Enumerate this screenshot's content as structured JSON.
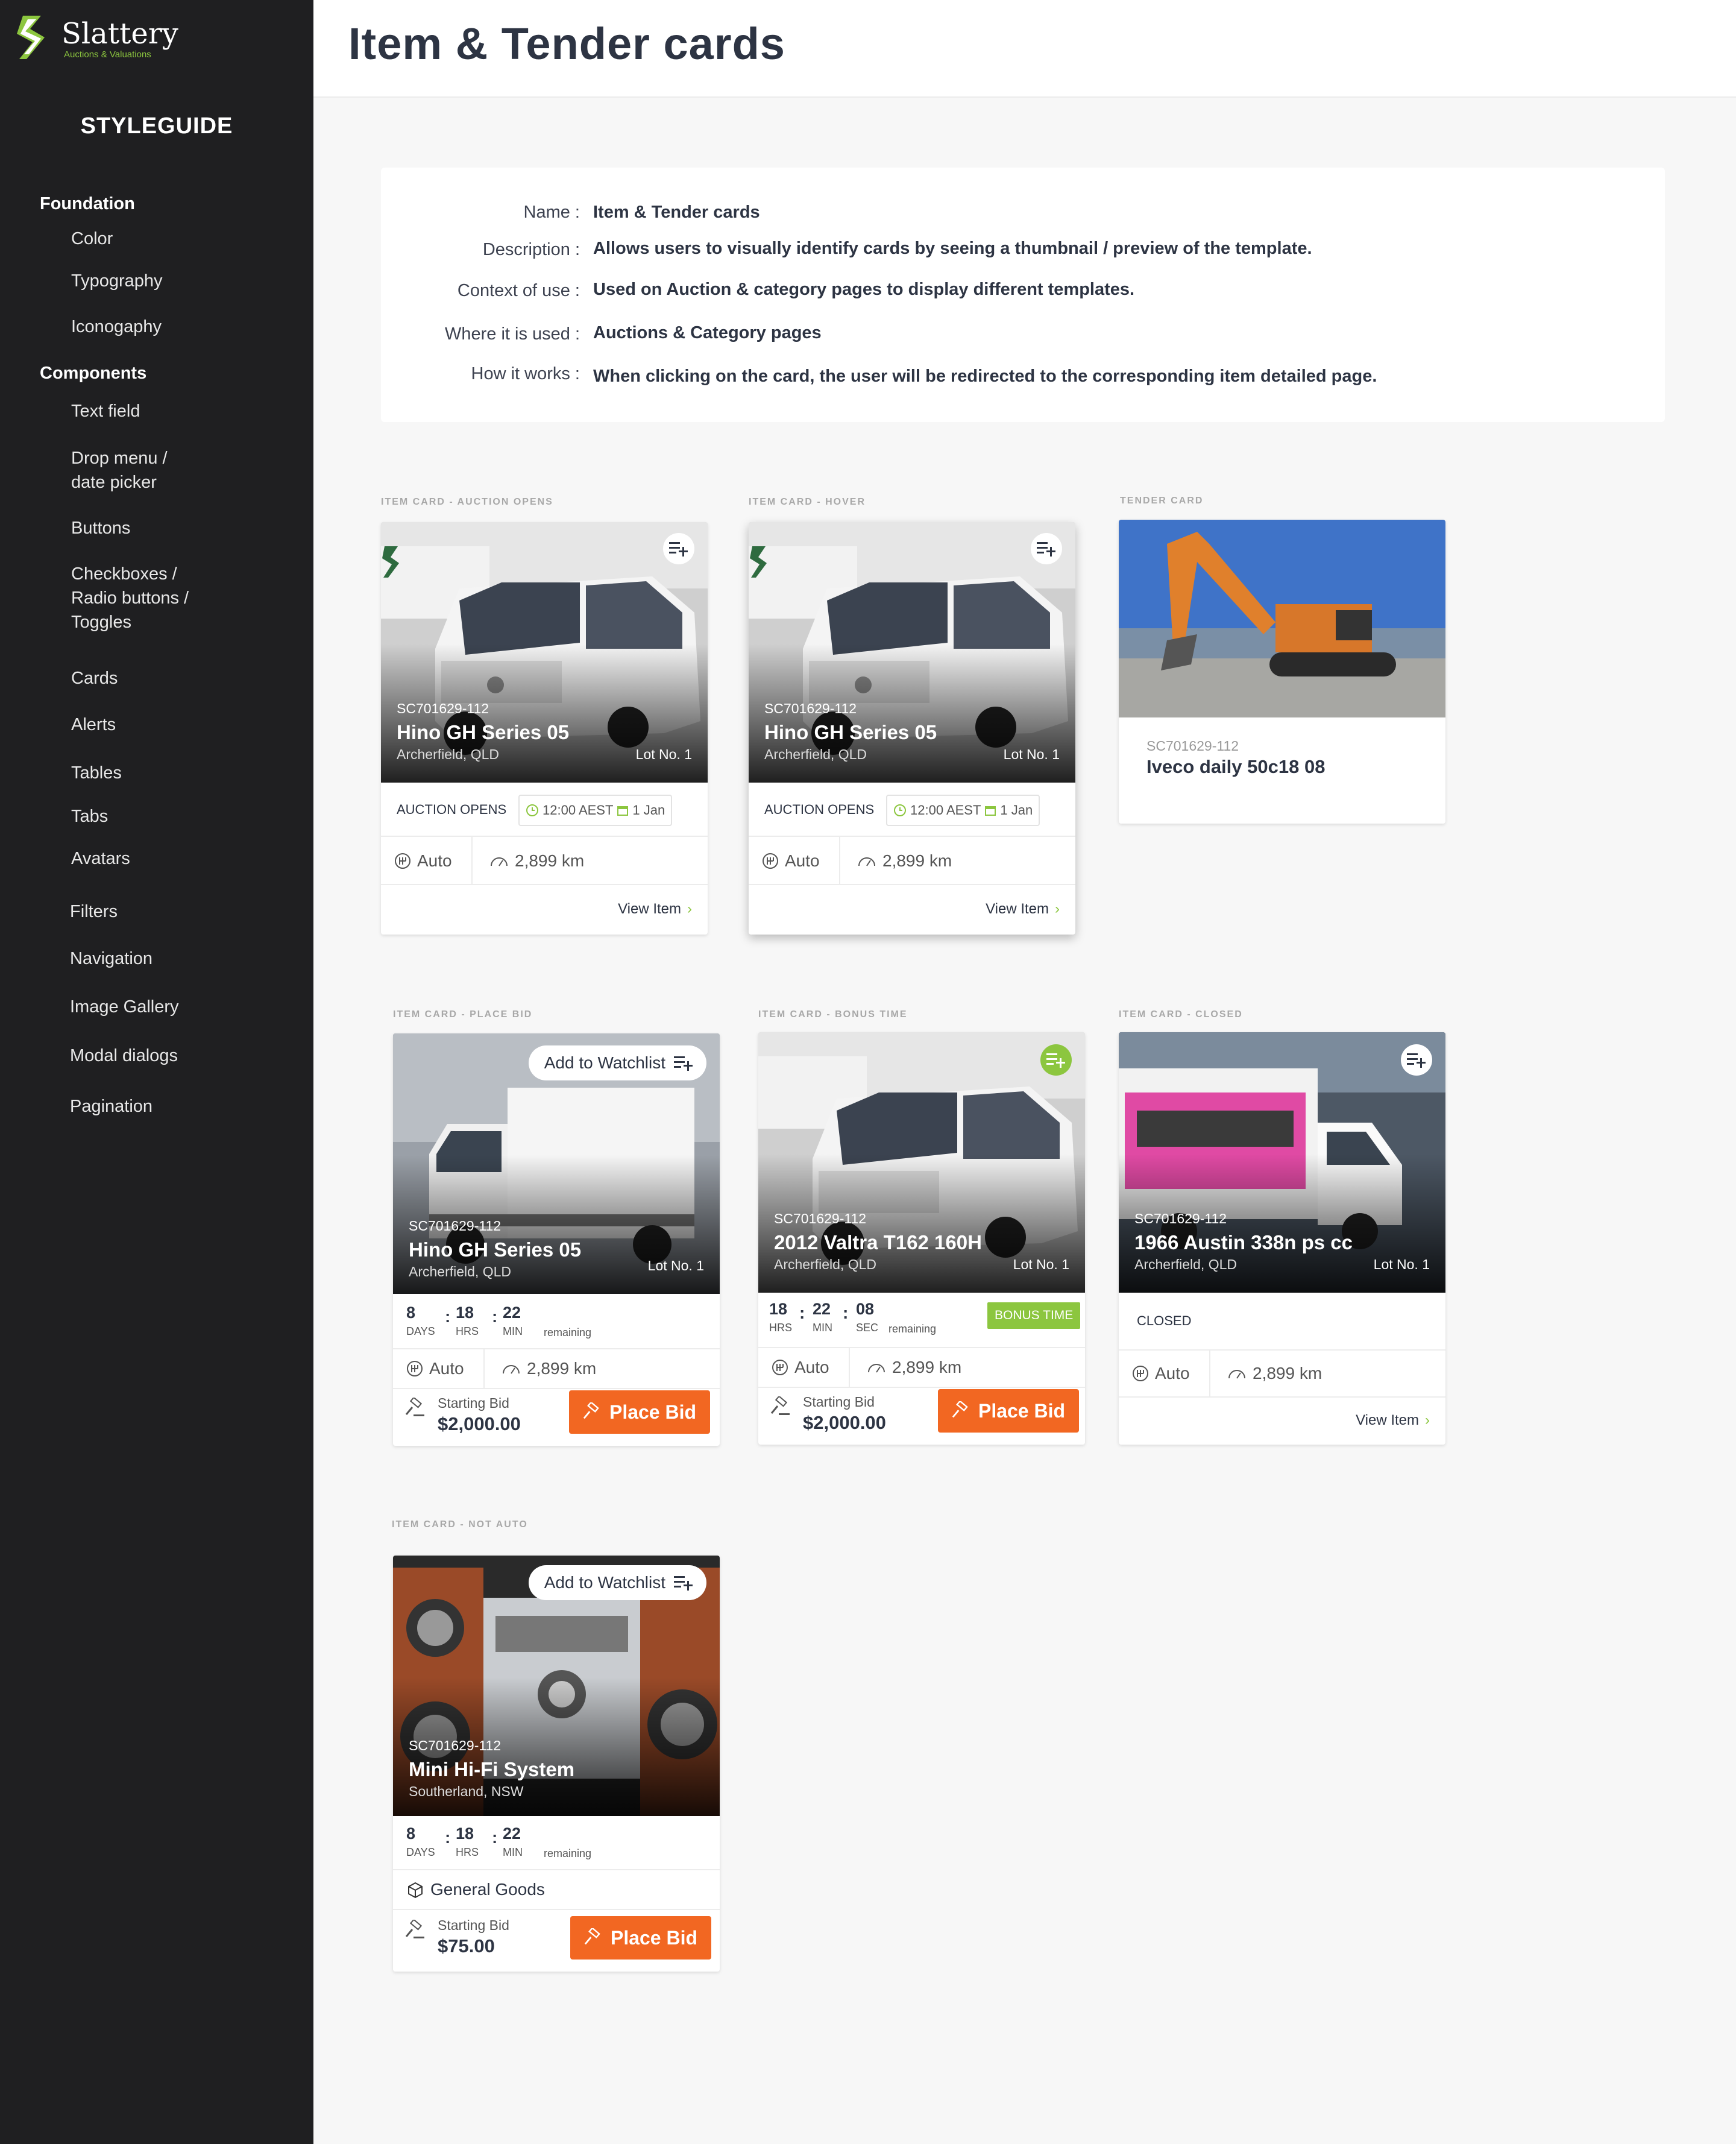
{
  "brand": {
    "name": "Slattery",
    "tagline": "Auctions & Valuations",
    "accent": "#8cc63f",
    "orange": "#f26722"
  },
  "sidebar": {
    "title": "STYLEGUIDE",
    "foundation_head": "Foundation",
    "foundation": [
      "Color",
      "Typography",
      "Iconogaphy"
    ],
    "components_head": "Components",
    "components": [
      "Text field",
      "Drop menu /",
      "date picker",
      "Buttons",
      "Checkboxes /",
      "Radio buttons /",
      "Toggles",
      "Cards",
      "Alerts",
      "Tables",
      "Tabs",
      "Avatars"
    ],
    "more": [
      "Filters",
      "Navigation",
      "Image  Gallery",
      "Modal dialogs",
      "Pagination"
    ]
  },
  "header": {
    "title": "Item & Tender cards"
  },
  "info": {
    "labels": [
      "Name :",
      "Description :",
      "Context of use :",
      "Where it is used :",
      "How it works :"
    ],
    "values": [
      "Item & Tender cards",
      "Allows users to visually identify cards by seeing a thumbnail / preview of the template.",
      "Used on Auction & category pages  to display different templates.",
      "Auctions & Category pages",
      "When clicking on the card, the user will be redirected to the corresponding item detailed page."
    ]
  },
  "sections": [
    "ITEM CARD - AUCTION OPENS",
    "ITEM CARD - HOVER",
    "TENDER CARD",
    "ITEM CARD - PLACE BID",
    "ITEM CARD - BONUS TIME",
    "ITEM CARD - CLOSED",
    "ITEM CARD - NOT AUTO"
  ],
  "common": {
    "code": "SC701629-112",
    "location": "Archerfield, QLD",
    "lot": "Lot No. 1",
    "auction_opens": "AUCTION OPENS",
    "time": "12:00 AEST",
    "date": "1 Jan",
    "auto": "Auto",
    "km": "2,899 km",
    "view_item": "View Item",
    "add_to_watchlist": "Add to Watchlist",
    "starting_bid": "Starting Bid",
    "place_bid": "Place Bid",
    "remaining": "remaining",
    "days": "DAYS",
    "hrs": "HRS",
    "min": "MIN",
    "sec": "SEC",
    "bonus_time": "BONUS TIME",
    "closed": "CLOSED"
  },
  "cards": {
    "c1": {
      "title": "Hino GH Series 05"
    },
    "c2": {
      "title": "Hino GH Series 05"
    },
    "tender": {
      "code": "SC701629-112",
      "title": "Iveco daily 50c18 08"
    },
    "c4": {
      "title": "Hino GH Series 05",
      "d": "8",
      "h": "18",
      "m": "22",
      "bid": "$2,000.00"
    },
    "c5": {
      "title": "2012 Valtra T162 160H",
      "h": "18",
      "m": "22",
      "s": "08",
      "bid": "$2,000.00"
    },
    "c6": {
      "title": "1966 Austin 338n ps cc"
    },
    "c7": {
      "title": "Mini Hi-Fi System",
      "location": "Southerland, NSW",
      "d": "8",
      "h": "18",
      "m": "22",
      "category": "General Goods",
      "bid": "$75.00"
    }
  }
}
